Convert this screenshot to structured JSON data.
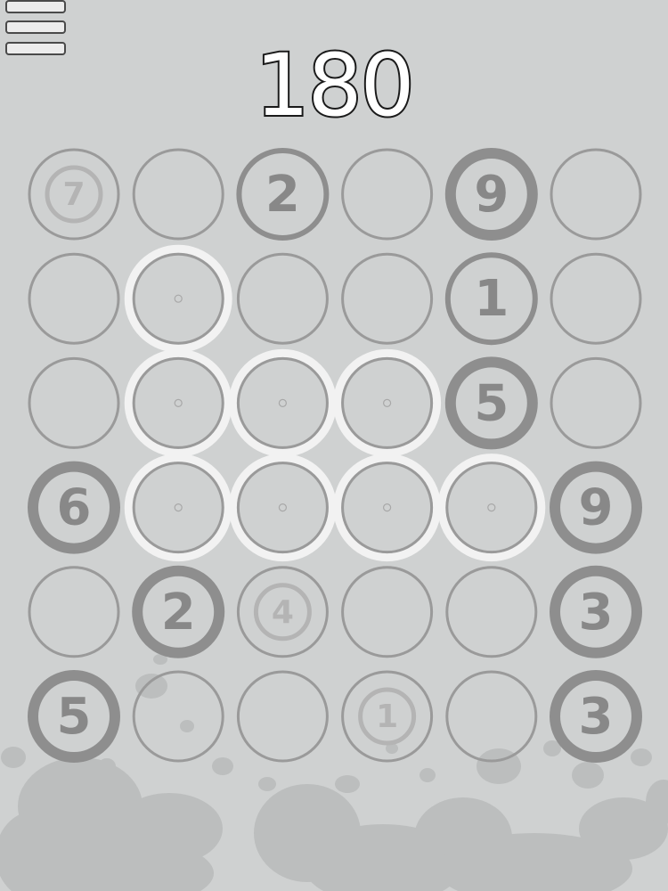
{
  "game": {
    "score": "180",
    "menu_icon": "hamburger-menu-icon"
  },
  "board": {
    "rows": 6,
    "cols": 6,
    "cells": [
      [
        {
          "state": "faded",
          "value": "7"
        },
        {
          "state": "empty",
          "value": ""
        },
        {
          "state": "filled",
          "value": "2"
        },
        {
          "state": "empty",
          "value": ""
        },
        {
          "state": "dark",
          "value": "9"
        },
        {
          "state": "empty",
          "value": ""
        }
      ],
      [
        {
          "state": "empty",
          "value": ""
        },
        {
          "state": "selected",
          "value": ""
        },
        {
          "state": "empty",
          "value": ""
        },
        {
          "state": "empty",
          "value": ""
        },
        {
          "state": "filled",
          "value": "1"
        },
        {
          "state": "empty",
          "value": ""
        }
      ],
      [
        {
          "state": "empty",
          "value": ""
        },
        {
          "state": "selected",
          "value": ""
        },
        {
          "state": "selected",
          "value": ""
        },
        {
          "state": "selected",
          "value": ""
        },
        {
          "state": "dark",
          "value": "5"
        },
        {
          "state": "empty",
          "value": ""
        }
      ],
      [
        {
          "state": "dark",
          "value": "6"
        },
        {
          "state": "selected",
          "value": ""
        },
        {
          "state": "selected",
          "value": ""
        },
        {
          "state": "selected",
          "value": ""
        },
        {
          "state": "selected",
          "value": ""
        },
        {
          "state": "dark",
          "value": "9"
        }
      ],
      [
        {
          "state": "empty",
          "value": ""
        },
        {
          "state": "dark",
          "value": "2"
        },
        {
          "state": "faded",
          "value": "4"
        },
        {
          "state": "empty",
          "value": ""
        },
        {
          "state": "empty",
          "value": ""
        },
        {
          "state": "dark",
          "value": "3"
        }
      ],
      [
        {
          "state": "dark",
          "value": "5"
        },
        {
          "state": "empty",
          "value": ""
        },
        {
          "state": "empty",
          "value": ""
        },
        {
          "state": "faded",
          "value": "1"
        },
        {
          "state": "empty",
          "value": ""
        },
        {
          "state": "dark",
          "value": "3"
        }
      ]
    ]
  },
  "colors": {
    "background": "#cfd1d1",
    "ring": "#9a9a9a",
    "ring_dark": "#8e8e8e",
    "number": "#888888",
    "faded": "#b4b4b4",
    "selected_glow": "#f2f2f2",
    "splatter": "#bdbfbf"
  }
}
